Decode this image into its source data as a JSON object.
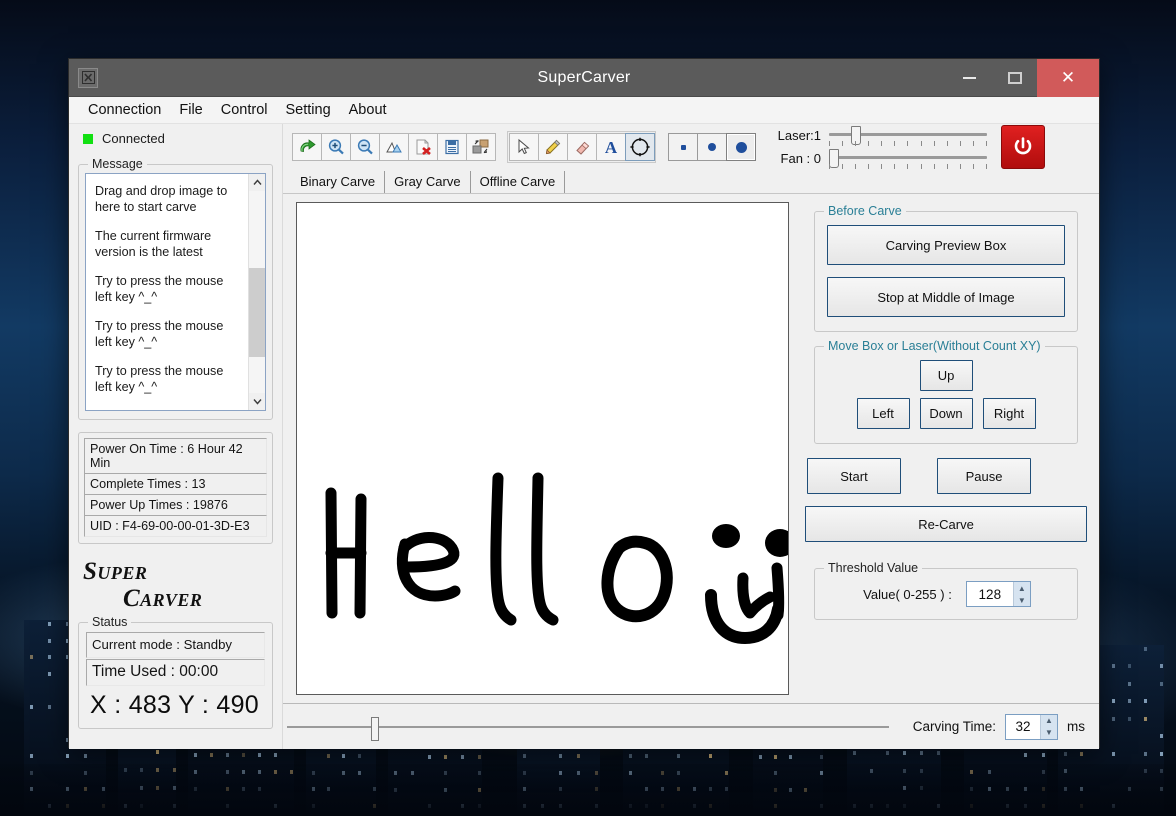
{
  "window": {
    "title": "SuperCarver",
    "app_icon": "app-logo-icon",
    "minimize": "minimize-icon",
    "maximize": "maximize-icon",
    "close": "✕"
  },
  "menu": {
    "items": [
      {
        "label": "Connection"
      },
      {
        "label": "File"
      },
      {
        "label": "Control"
      },
      {
        "label": "Setting"
      },
      {
        "label": "About"
      }
    ]
  },
  "left": {
    "connection_status": "Connected",
    "connection_color": "#12e012",
    "message_group_legend": "Message",
    "messages": [
      "Drag and drop image to here to start carve",
      "The current firmware version is the latest",
      "Try to press the mouse left key ^_^",
      "Try to press the mouse left key ^_^",
      "Try to press the mouse left key ^_^"
    ],
    "stats": [
      "Power On Time : 6 Hour 42 Min",
      "Complete Times : 13",
      "Power Up Times : 19876",
      "UID : F4-69-00-00-01-3D-E3"
    ],
    "brand_line1": "Super",
    "brand_line2": "Carver",
    "status_legend": "Status",
    "current_mode": "Current mode : Standby",
    "time_used": "Time Used :  00:00",
    "xy_readout": "X : 483  Y : 490"
  },
  "toolbar": {
    "buttons": [
      {
        "name": "undo-icon",
        "title": "Undo"
      },
      {
        "name": "zoom-in-icon",
        "title": "Zoom In"
      },
      {
        "name": "zoom-out-icon",
        "title": "Zoom Out"
      },
      {
        "name": "fit-image-icon",
        "title": "Fit"
      },
      {
        "name": "delete-file-icon",
        "title": "Delete"
      },
      {
        "name": "save-icon",
        "title": "Save"
      },
      {
        "name": "swap-layers-icon",
        "title": "Swap"
      }
    ],
    "tools": [
      {
        "name": "pointer-icon",
        "title": "Select",
        "pressed": false
      },
      {
        "name": "pencil-icon",
        "title": "Pencil",
        "pressed": false
      },
      {
        "name": "eraser-icon",
        "title": "Eraser",
        "pressed": false
      },
      {
        "name": "text-icon",
        "title": "Text",
        "pressed": false
      },
      {
        "name": "crosshair-icon",
        "title": "Target",
        "pressed": true
      }
    ],
    "brush_sizes": [
      {
        "name": "brush-small-icon",
        "size": 5,
        "active": false
      },
      {
        "name": "brush-medium-icon",
        "size": 8,
        "active": false
      },
      {
        "name": "brush-large-icon",
        "size": 11,
        "active": true
      }
    ],
    "laser_label": "Laser:1",
    "laser_value": 1,
    "fan_label": "Fan : 0",
    "fan_value": 0,
    "power_icon": "power-icon",
    "power_color": "#d11414"
  },
  "tabs": [
    {
      "label": "Binary Carve",
      "active": true
    },
    {
      "label": "Gray Carve",
      "active": false
    },
    {
      "label": "Offline Carve",
      "active": false
    }
  ],
  "canvas": {
    "name": "carving-canvas",
    "content_description": "Hello with smiley face",
    "background": "#ffffff",
    "stroke_color": "#000000"
  },
  "controls": {
    "before_carve": {
      "legend": "Before Carve",
      "legend_color": "#2a7f96",
      "buttons": [
        {
          "label": "Carving Preview Box"
        },
        {
          "label": "Stop at Middle of Image"
        }
      ]
    },
    "move_box": {
      "legend": "Move Box or Laser(Without Count XY)",
      "legend_color": "#2a7f96",
      "up": "Up",
      "left": "Left",
      "down": "Down",
      "right": "Right"
    },
    "actions": {
      "start": "Start",
      "pause": "Pause",
      "recarve": "Re-Carve"
    },
    "threshold": {
      "legend": "Threshold Value",
      "legend_color": "#222222",
      "value_label": "Value( 0-255 ) :",
      "value": "128"
    }
  },
  "bottom": {
    "carving_time_label": "Carving Time:",
    "carving_time_value": "32",
    "carving_time_unit": "ms",
    "slider_position_pct": 10
  }
}
